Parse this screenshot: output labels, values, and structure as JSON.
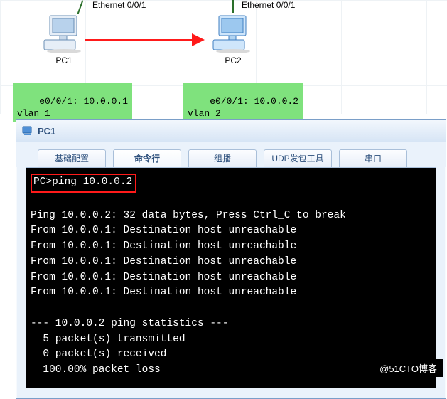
{
  "topology": {
    "pc1": {
      "label": "PC1",
      "eth_label": "Ethernet 0/0/1"
    },
    "pc2": {
      "label": "PC2",
      "eth_label": "Ethernet 0/0/1"
    },
    "cfg1_line1": "e0/0/1: 10.0.0.1",
    "cfg1_line2": "vlan 1",
    "cfg2_line1": "e0/0/1: 10.0.0.2",
    "cfg2_line2": "vlan 2"
  },
  "window": {
    "title": "PC1",
    "tabs": {
      "basic": "基础配置",
      "cli": "命令行",
      "mcast": "组播",
      "udp": "UDP发包工具",
      "serial": "串口"
    },
    "active_tab": "cli"
  },
  "console": {
    "prompt": "PC>",
    "command": "ping 10.0.0.2",
    "lines": [
      "",
      "Ping 10.0.0.2: 32 data bytes, Press Ctrl_C to break",
      "From 10.0.0.1: Destination host unreachable",
      "From 10.0.0.1: Destination host unreachable",
      "From 10.0.0.1: Destination host unreachable",
      "From 10.0.0.1: Destination host unreachable",
      "From 10.0.0.1: Destination host unreachable",
      "",
      "--- 10.0.0.2 ping statistics ---",
      "  5 packet(s) transmitted",
      "  0 packet(s) received",
      "  100.00% packet loss"
    ]
  },
  "watermark": "@51CTO博客"
}
